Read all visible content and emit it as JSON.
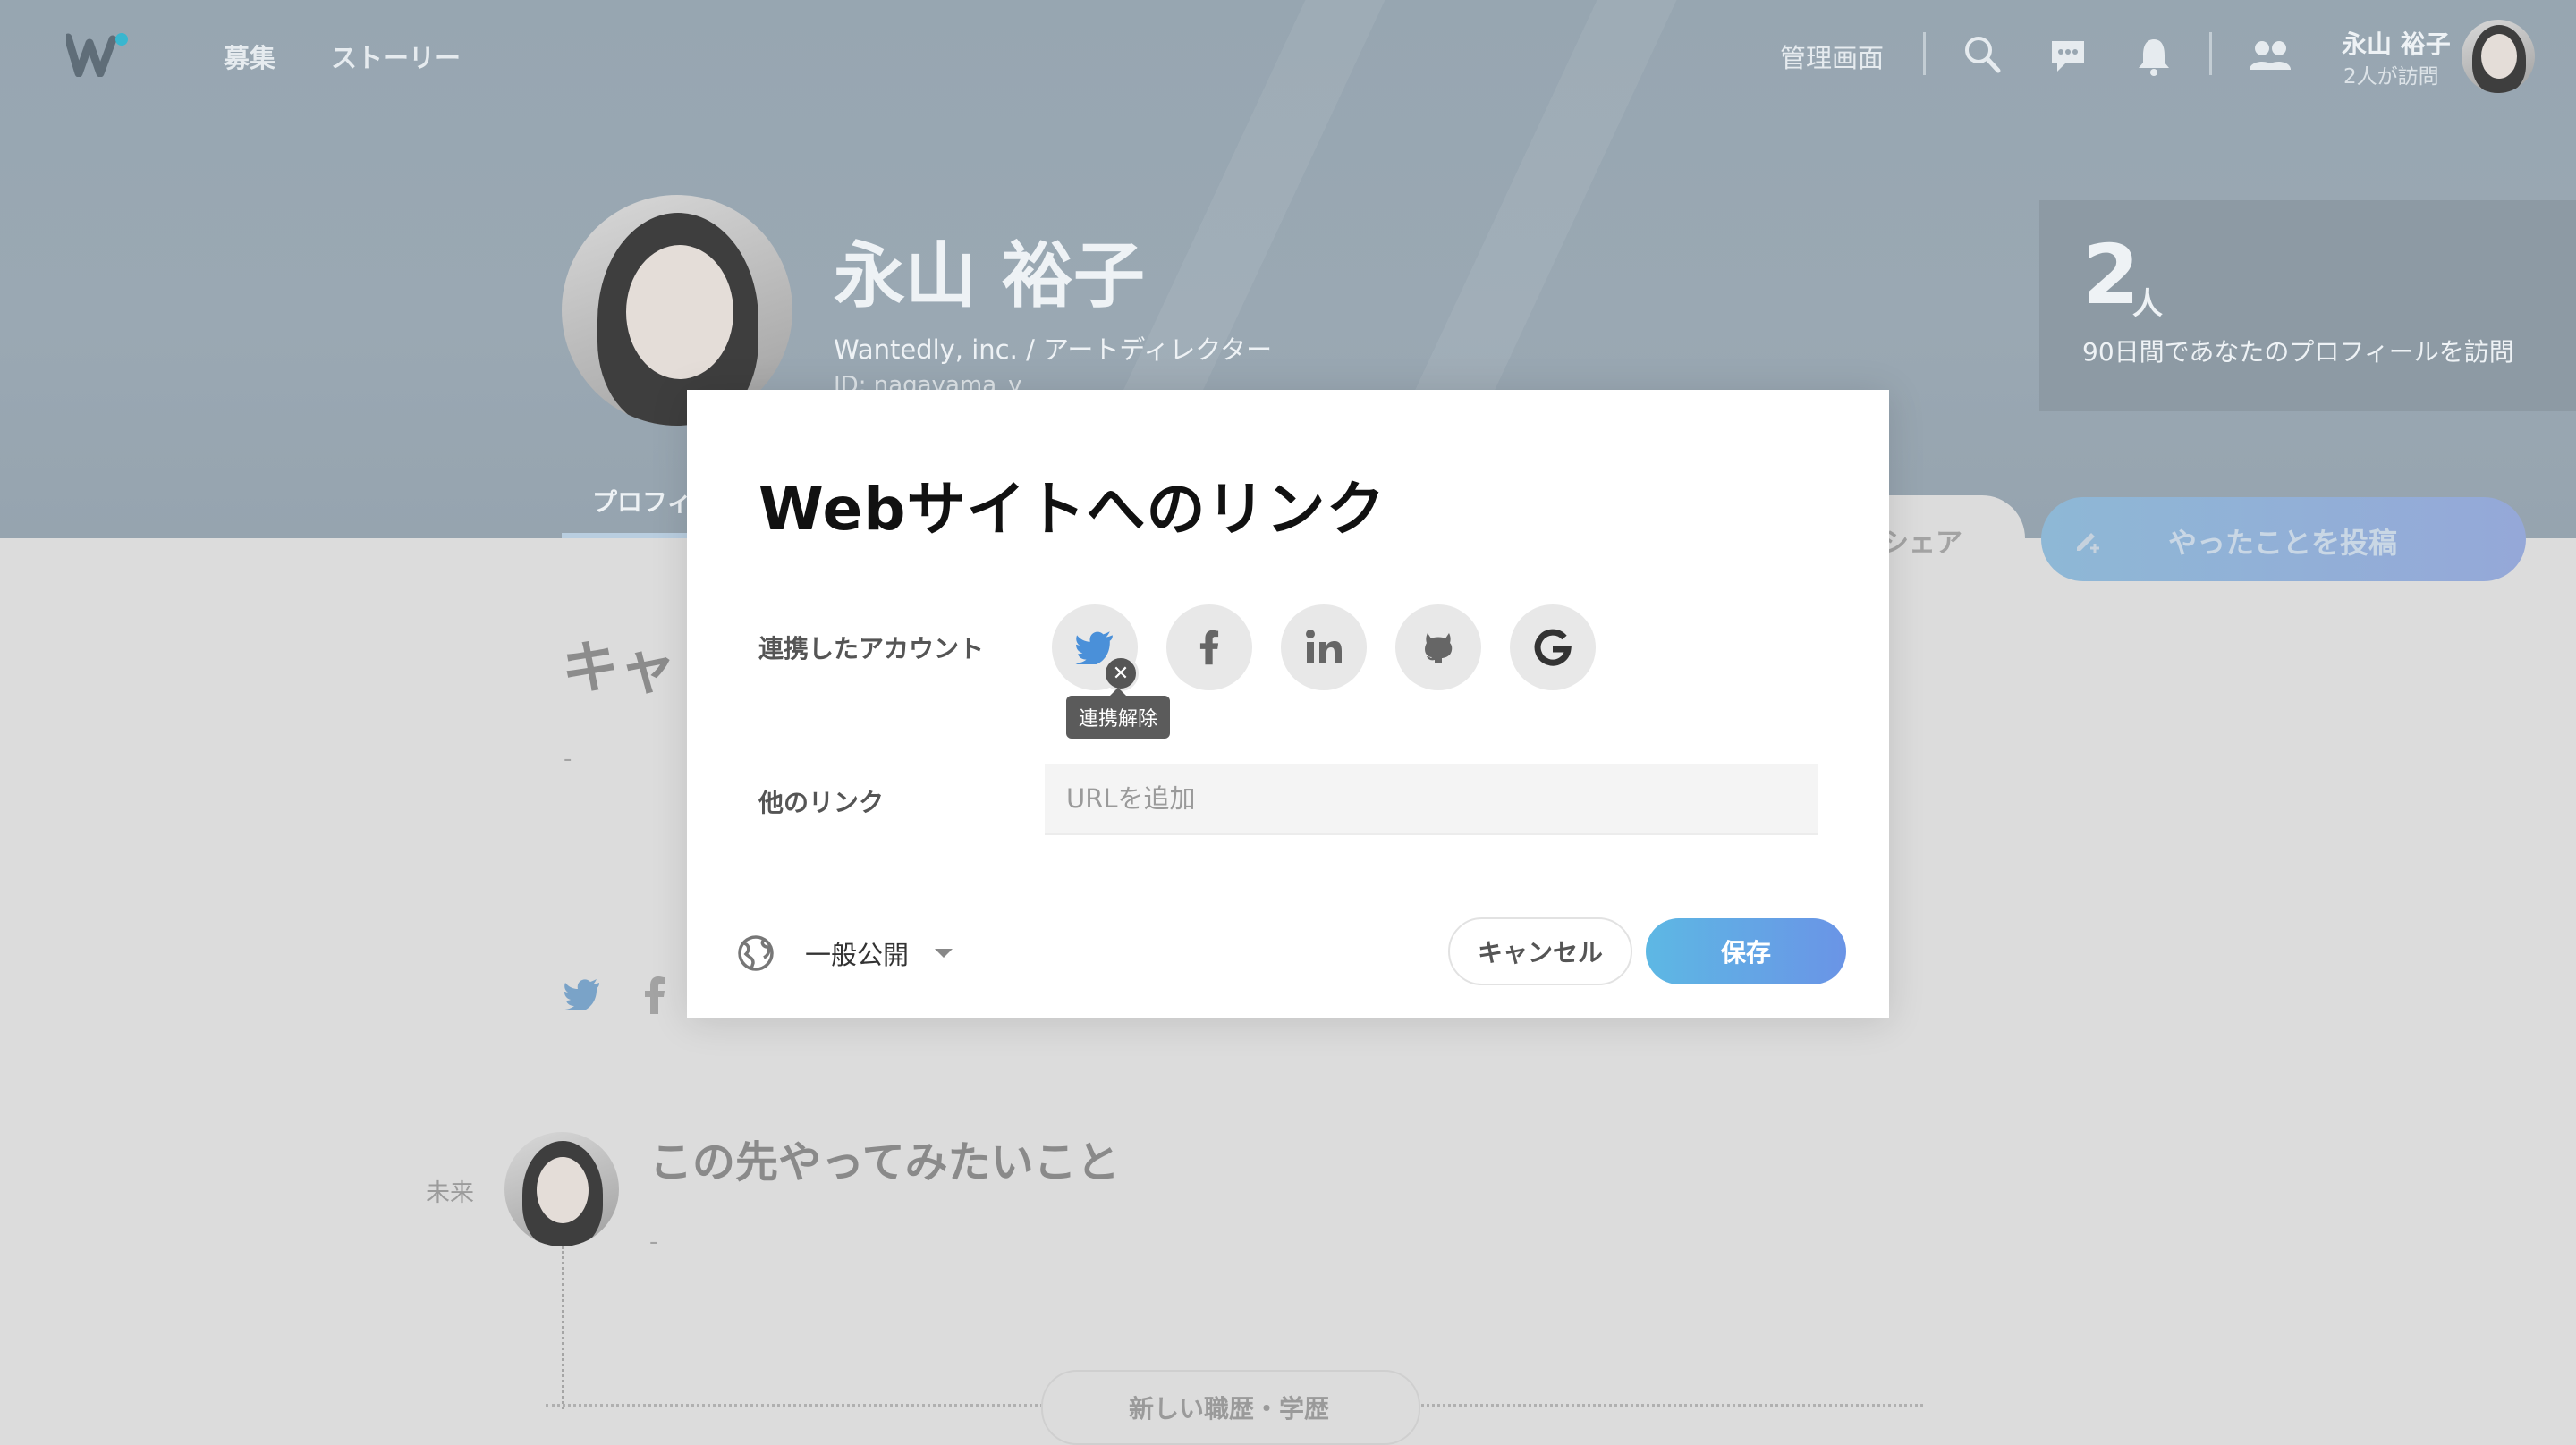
{
  "header": {
    "nav": [
      "募集",
      "ストーリー"
    ],
    "admin_label": "管理画面",
    "user_name": "永山 裕子",
    "user_visits": "2人が訪問"
  },
  "profile": {
    "name": "永山 裕子",
    "company_role": "Wantedly, inc. / アートディレクター",
    "id_partial": "ID: nagayama_y",
    "tab_partial": "プロフィ",
    "visits_count": "2",
    "visits_unit": "人",
    "visits_caption": "90日間であなたのプロフィールを訪問",
    "share_partial": "シェア",
    "post_button": "やったことを投稿",
    "section_partial": "キャ",
    "dash1": "-",
    "future_label": "未来",
    "future_title": "この先やってみたいこと",
    "dash2": "-",
    "new_career_partial": "新しい職歴・学歴"
  },
  "modal": {
    "title": "Webサイトへのリンク",
    "accounts_label": "連携したアカウント",
    "accounts": [
      {
        "name": "twitter",
        "linked": true
      },
      {
        "name": "facebook",
        "linked": false
      },
      {
        "name": "linkedin",
        "linked": false
      },
      {
        "name": "github",
        "linked": false
      },
      {
        "name": "google",
        "linked": false
      }
    ],
    "unlink_tooltip": "連携解除",
    "other_links_label": "他のリンク",
    "url_placeholder": "URLを追加",
    "visibility": "一般公開",
    "cancel": "キャンセル",
    "save": "保存"
  },
  "colors": {
    "twitter_blue": "#4a90d9",
    "save_gradient_start": "#5db8e4",
    "save_gradient_end": "#6a94e6"
  }
}
